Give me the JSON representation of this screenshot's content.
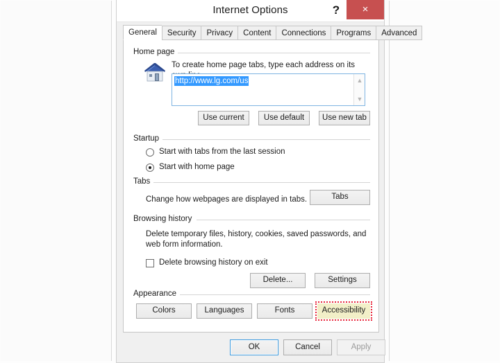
{
  "window": {
    "title": "Internet Options",
    "help_label": "?",
    "close_label": "×",
    "close_color": "#c75050"
  },
  "tabs": [
    {
      "label": "General",
      "active": true
    },
    {
      "label": "Security",
      "active": false
    },
    {
      "label": "Privacy",
      "active": false
    },
    {
      "label": "Content",
      "active": false
    },
    {
      "label": "Connections",
      "active": false
    },
    {
      "label": "Programs",
      "active": false
    },
    {
      "label": "Advanced",
      "active": false
    }
  ],
  "home_page": {
    "group_title": "Home page",
    "icon": "house-icon",
    "description": "To create home page tabs, type each address on its own line.",
    "url_value": "http://www.lg.com/us",
    "selection_color": "#3399ff",
    "buttons": [
      {
        "label": "Use current"
      },
      {
        "label": "Use default"
      },
      {
        "label": "Use new tab"
      }
    ]
  },
  "startup": {
    "group_title": "Startup",
    "options": [
      {
        "label": "Start with tabs from the last session",
        "checked": false
      },
      {
        "label": "Start with home page",
        "checked": true
      }
    ]
  },
  "tabs_section": {
    "group_title": "Tabs",
    "description": "Change how webpages are displayed in tabs.",
    "button_label": "Tabs"
  },
  "browsing_history": {
    "group_title": "Browsing history",
    "description_line1": "Delete temporary files, history, cookies, saved passwords, and",
    "description_line2": "web form information.",
    "checkbox_label": "Delete browsing history on exit",
    "checkbox_checked": false,
    "buttons": [
      {
        "label": "Delete..."
      },
      {
        "label": "Settings"
      }
    ]
  },
  "appearance": {
    "group_title": "Appearance",
    "buttons": [
      {
        "label": "Colors",
        "highlighted": false
      },
      {
        "label": "Languages",
        "highlighted": false
      },
      {
        "label": "Fonts",
        "highlighted": false
      },
      {
        "label": "Accessibility",
        "highlighted": true
      }
    ],
    "highlight_border_color": "#e8243a",
    "highlight_fill_color": "#f2efc8"
  },
  "footer": {
    "ok_label": "OK",
    "cancel_label": "Cancel",
    "apply_label": "Apply",
    "apply_disabled": true
  }
}
